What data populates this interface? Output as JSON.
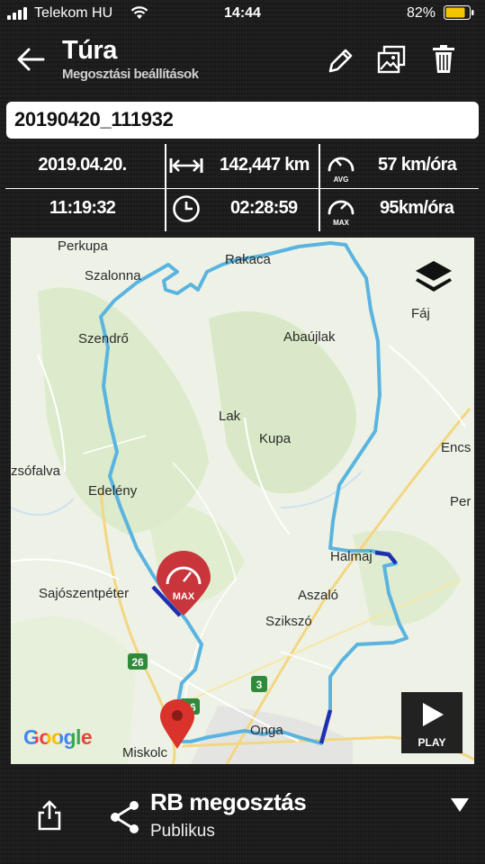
{
  "status": {
    "carrier": "Telekom HU",
    "time": "14:44",
    "battery_pct": "82%",
    "battery_color": "#f5c400"
  },
  "header": {
    "title": "Túra",
    "subtitle": "Megosztási beállítások",
    "icons": [
      "back-arrow-icon",
      "pencil-icon",
      "image-icon",
      "trash-icon"
    ]
  },
  "track_name": "20190420_111932",
  "stats": {
    "date": "2019.04.20.",
    "start_time": "11:19:32",
    "distance": "142,447 km",
    "duration": "02:28:59",
    "avg_speed": "57 km/óra",
    "max_speed": "95km/óra",
    "avg_label": "AVG",
    "max_label": "MAX"
  },
  "map": {
    "places": [
      "Perkupa",
      "Szalonna",
      "Rakaca",
      "Fáj",
      "Szendrő",
      "Abaújlak",
      "Lak",
      "Kupa",
      "Encs",
      "zsófalva",
      "Edelény",
      "Per",
      "Halmaj",
      "Sajószentpéter",
      "Aszaló",
      "Szikszó",
      "Onga",
      "Miskolc"
    ],
    "road_badges": [
      "26",
      "3",
      "26"
    ],
    "max_marker_label": "MAX",
    "google_logo": "Google",
    "play_label": "PLAY",
    "route_color": "#5ab4e0",
    "fast_segment_color": "#1f2fb0",
    "max_marker_color": "#c8353b",
    "start_pin_color": "#d9332b"
  },
  "share": {
    "title": "RB megosztás",
    "subtitle": "Publikus"
  }
}
